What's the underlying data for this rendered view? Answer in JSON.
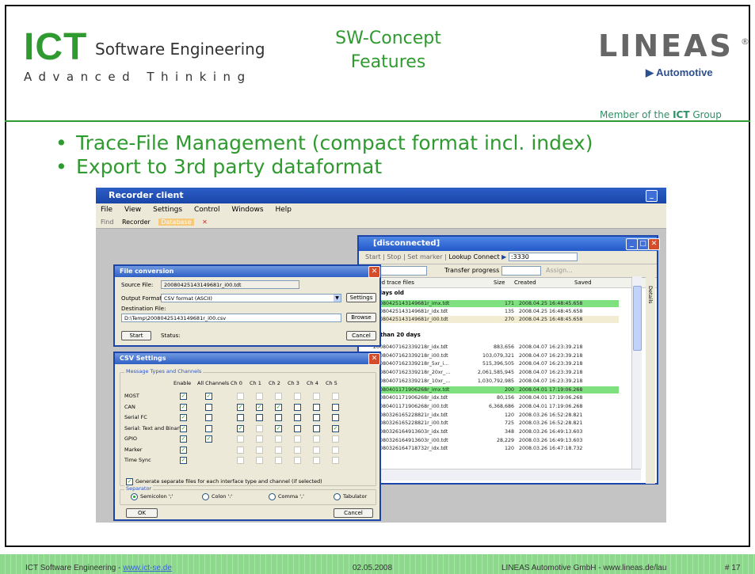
{
  "header": {
    "ict_logo": "ICT",
    "ict_sub": "Software Engineering",
    "ict_tag": "Advanced Thinking",
    "title_line1": "SW-Concept",
    "title_line2": "Features",
    "lineas_logo": "LINEAS",
    "lineas_reg": "®",
    "lineas_auto": "▶ Automotive",
    "member_prefix": "Member of the ",
    "member_bold": "ICT",
    "member_suffix": " Group"
  },
  "bullets": [
    "Trace-File Management (compact format incl. index)",
    "Export to 3rd party dataformat"
  ],
  "recorder": {
    "title": "Recorder client",
    "menu": [
      "File",
      "View",
      "Settings",
      "Control",
      "Windows",
      "Help"
    ],
    "toolbar": [
      "Find",
      "Recorder",
      "Database"
    ]
  },
  "disconnected": {
    "title": "[disconnected]",
    "toolbar": [
      "Start",
      "Stop",
      "Set marker",
      "Lookup",
      "Connect",
      ":3330"
    ],
    "space_label": "space",
    "progress_label": "Transfer progress",
    "assign_label": "Assign...",
    "columns": [
      "etrieved trace files",
      "Size",
      "Created",
      "Saved"
    ],
    "details_tab": "Details",
    "group1": "2 - 5 days old",
    "group2": "older than 20 days",
    "rows1": [
      {
        "name": "20080425143149681r_imx.tdt",
        "size": "171",
        "created": "2008.04.25 16:48:45.658",
        "style": "g"
      },
      {
        "name": "20080425143149681r_idx.tdt",
        "size": "135",
        "created": "2008.04.25 16:48:45.658",
        "style": ""
      },
      {
        "name": "20080425143149681r_i00.tdt",
        "size": "270",
        "created": "2008.04.25 16:48:45.658",
        "style": "s"
      }
    ],
    "rows2": [
      {
        "name": "20080407162339218r_idx.tdt",
        "size": "883,656",
        "created": "2008.04.07 16:23:39.218",
        "style": ""
      },
      {
        "name": "20080407162339218r_i00.tdt",
        "size": "103,079,321",
        "created": "2008.04.07 16:23:39.218",
        "style": ""
      },
      {
        "name": "20080407162339218r_5xr_i...",
        "size": "515,396,505",
        "created": "2008.04.07 16:23:39.218",
        "style": ""
      },
      {
        "name": "20080407162339218r_20xr_...",
        "size": "2,061,585,945",
        "created": "2008.04.07 16:23:39.218",
        "style": ""
      },
      {
        "name": "20080407162339218r_10xr_...",
        "size": "1,030,792,985",
        "created": "2008.04.07 16:23:39.218",
        "style": ""
      },
      {
        "name": "20080401171906268r_imx.tdt",
        "size": "200",
        "created": "2008.04.01 17:19:06.268",
        "style": "g"
      },
      {
        "name": "20080401171906268r_idx.tdt",
        "size": "80,156",
        "created": "2008.04.01 17:19:06.268",
        "style": ""
      },
      {
        "name": "20080401171906268r_i00.tdt",
        "size": "6,368,686",
        "created": "2008.04.01 17:19:06.268",
        "style": ""
      },
      {
        "name": "20080326165228821r_idx.tdt",
        "size": "120",
        "created": "2008.03.26 16:52:28.821",
        "style": ""
      },
      {
        "name": "20080326165228821r_i00.tdt",
        "size": "725",
        "created": "2008.03.26 16:52:28.821",
        "style": ""
      },
      {
        "name": "20080326164913603r_idx.tdt",
        "size": "348",
        "created": "2008.03.26 16:49:13.603",
        "style": ""
      },
      {
        "name": "20080326164913603r_i00.tdt",
        "size": "28,229",
        "created": "2008.03.26 16:49:13.603",
        "style": ""
      },
      {
        "name": "20080326164718732r_idx.tdt",
        "size": "120",
        "created": "2008.03.26 16:47:18.732",
        "style": ""
      }
    ]
  },
  "file_conversion": {
    "title": "File conversion",
    "source_label": "Source File:",
    "source_value": "20080425143149681r_i00.tdt",
    "format_label": "Output Format:",
    "format_value": "CSV format (ASCII)",
    "settings_btn": "Settings",
    "dest_label": "Destination File:",
    "dest_value": "D:\\Temp\\20080425143149681r_i00.csv",
    "browse_btn": "Browse",
    "start_btn": "Start",
    "status_label": "Status:",
    "cancel_btn": "Cancel"
  },
  "csv": {
    "title": "CSV Settings",
    "group_caption": "Message Types and Channels",
    "headers": [
      "Enable",
      "All Channels",
      "Ch 0",
      "Ch 1",
      "Ch 2",
      "Ch 3",
      "Ch 4",
      "Ch 5"
    ],
    "rows": [
      {
        "name": "MOST",
        "enable": true,
        "all": true,
        "chans": [
          null,
          null,
          null,
          null,
          null,
          null
        ]
      },
      {
        "name": "CAN",
        "enable": true,
        "all": false,
        "chans": [
          true,
          true,
          true,
          false,
          false,
          false
        ]
      },
      {
        "name": "Serial FC",
        "enable": true,
        "all": false,
        "chans": [
          false,
          false,
          false,
          false,
          false,
          false
        ]
      },
      {
        "name": "Serial: Text and Binary",
        "enable": true,
        "all": false,
        "chans": [
          true,
          null,
          true,
          false,
          false,
          true
        ]
      },
      {
        "name": "GPIO",
        "enable": true,
        "all": true,
        "chans": [
          null,
          null,
          null,
          null,
          null,
          null
        ]
      },
      {
        "name": "Marker",
        "enable": true,
        "all": null,
        "chans": [
          null,
          null,
          null,
          null,
          null,
          null
        ]
      },
      {
        "name": "Time Sync",
        "enable": true,
        "all": null,
        "chans": [
          null,
          null,
          null,
          null,
          null,
          null
        ]
      }
    ],
    "separate_files": "Generate separate files for each interface type and channel (if selected)",
    "separator_caption": "Separator",
    "separators": [
      "Semicolon ';'",
      "Colon ':'",
      "Comma ','",
      "Tabulator"
    ],
    "ok_btn": "OK",
    "cancel_btn": "Cancel"
  },
  "footer": {
    "left_prefix": "ICT Software Engineering - ",
    "left_link": "www.ict-se.de",
    "date": "02.05.2008",
    "right": "LINEAS Automotive GmbH - www.lineas.de/lau",
    "page": "# 17"
  },
  "colors": {
    "accent_green": "#2f9a2f",
    "xp_blue": "#1b45a8",
    "highlight_row": "#7ee07e"
  }
}
